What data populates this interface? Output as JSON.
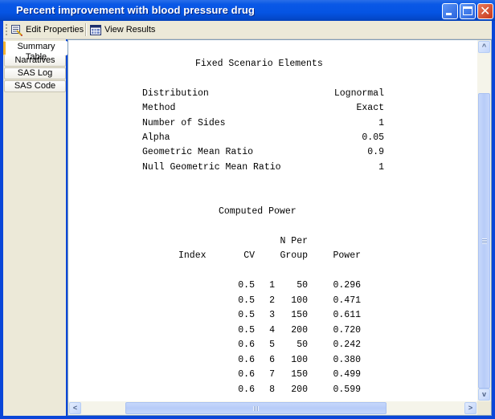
{
  "window": {
    "title": "Percent improvement with blood pressure drug",
    "controls": {
      "minimize": "minimize-icon",
      "maximize": "maximize-icon",
      "close": "close-icon"
    }
  },
  "toolbar": {
    "edit_properties_label": "Edit Properties",
    "edit_properties_icon": "properties-icon",
    "view_results_label": "View Results",
    "view_results_icon": "table-window-icon"
  },
  "tabs": [
    {
      "label": "Summary Table",
      "active": true
    },
    {
      "label": "Narratives",
      "active": false
    },
    {
      "label": "SAS Log",
      "active": false
    },
    {
      "label": "SAS Code",
      "active": false
    }
  ],
  "report": {
    "fixed_title": "Fixed Scenario Elements",
    "fixed_elements": [
      {
        "label": "Distribution",
        "value": "Lognormal"
      },
      {
        "label": "Method",
        "value": "Exact"
      },
      {
        "label": "Number of Sides",
        "value": "1"
      },
      {
        "label": "Alpha",
        "value": "0.05"
      },
      {
        "label": "Geometric Mean Ratio",
        "value": "0.9"
      },
      {
        "label": "Null Geometric Mean Ratio",
        "value": "1"
      }
    ],
    "computed_title": "Computed Power",
    "columns": {
      "index": "Index",
      "cv": "CV",
      "n_top": "N Per",
      "n_bottom": "Group",
      "power": "Power"
    },
    "rows": [
      {
        "index": "1",
        "cv": "0.5",
        "n": "50",
        "power": "0.296"
      },
      {
        "index": "2",
        "cv": "0.5",
        "n": "100",
        "power": "0.471"
      },
      {
        "index": "3",
        "cv": "0.5",
        "n": "150",
        "power": "0.611"
      },
      {
        "index": "4",
        "cv": "0.5",
        "n": "200",
        "power": "0.720"
      },
      {
        "index": "5",
        "cv": "0.6",
        "n": "50",
        "power": "0.242"
      },
      {
        "index": "6",
        "cv": "0.6",
        "n": "100",
        "power": "0.380"
      },
      {
        "index": "7",
        "cv": "0.6",
        "n": "150",
        "power": "0.499"
      },
      {
        "index": "8",
        "cv": "0.6",
        "n": "200",
        "power": "0.599"
      }
    ]
  },
  "scrollbars": {
    "vertical": {
      "up": "^",
      "down": "v"
    },
    "horizontal": {
      "left": "<",
      "right": ">"
    }
  }
}
